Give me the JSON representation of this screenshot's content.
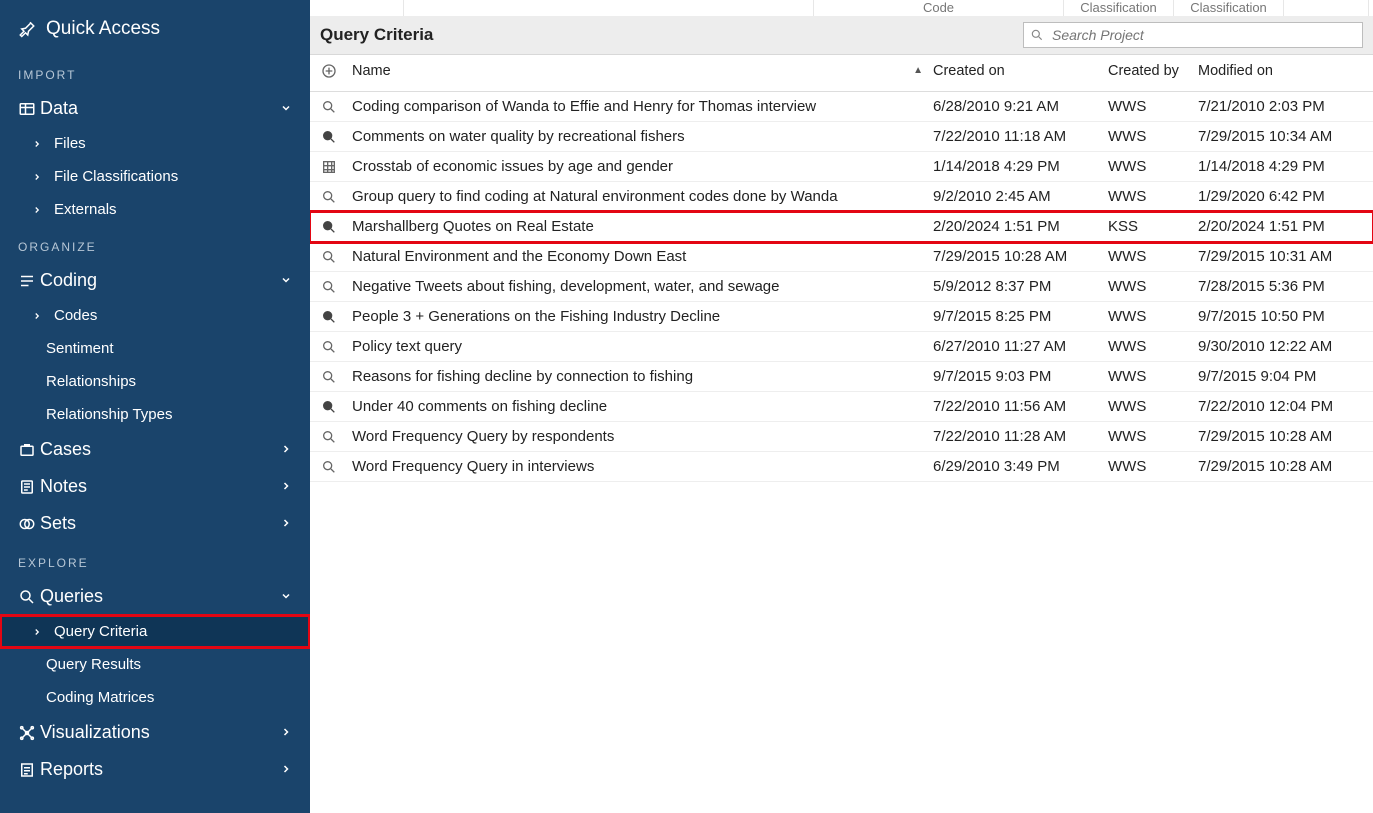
{
  "sidebar": {
    "quick_access": "Quick Access",
    "sections": {
      "import": "IMPORT",
      "organize": "ORGANIZE",
      "explore": "EXPLORE"
    },
    "data": {
      "label": "Data",
      "files": "Files",
      "file_class": "File Classifications",
      "externals": "Externals"
    },
    "coding": {
      "label": "Coding",
      "codes": "Codes",
      "sentiment": "Sentiment",
      "relationships": "Relationships",
      "rel_types": "Relationship Types"
    },
    "cases": "Cases",
    "notes": "Notes",
    "sets": "Sets",
    "queries": {
      "label": "Queries",
      "criteria": "Query Criteria",
      "results": "Query Results",
      "matrices": "Coding Matrices"
    },
    "visualizations": "Visualizations",
    "reports": "Reports"
  },
  "main": {
    "top_strip": {
      "code": "Code",
      "class1": "Classification",
      "class2": "Classification"
    },
    "criteria_title": "Query Criteria",
    "search_placeholder": "Search Project",
    "headers": {
      "name": "Name",
      "created": "Created on",
      "by": "Created by",
      "mod": "Modified on"
    },
    "rows": [
      {
        "icon": "mag",
        "name": "Coding comparison of Wanda to Effie and Henry for Thomas interview",
        "created": "6/28/2010 9:21 AM",
        "by": "WWS",
        "mod": "7/21/2010 2:03 PM"
      },
      {
        "icon": "magdark",
        "name": "Comments on water quality by recreational fishers",
        "created": "7/22/2010 11:18 AM",
        "by": "WWS",
        "mod": "7/29/2015 10:34 AM"
      },
      {
        "icon": "grid",
        "name": "Crosstab of economic issues by age and gender",
        "created": "1/14/2018 4:29 PM",
        "by": "WWS",
        "mod": "1/14/2018 4:29 PM"
      },
      {
        "icon": "mag",
        "name": "Group query to find coding at Natural environment codes done by Wanda",
        "created": "9/2/2010 2:45 AM",
        "by": "WWS",
        "mod": "1/29/2020 6:42 PM"
      },
      {
        "icon": "magdark",
        "name": "Marshallberg Quotes on Real Estate",
        "created": "2/20/2024 1:51 PM",
        "by": "KSS",
        "mod": "2/20/2024 1:51 PM",
        "hl": true
      },
      {
        "icon": "mag",
        "name": "Natural Environment and the Economy Down East",
        "created": "7/29/2015 10:28 AM",
        "by": "WWS",
        "mod": "7/29/2015 10:31 AM"
      },
      {
        "icon": "mag",
        "name": "Negative Tweets about fishing, development, water, and sewage",
        "created": "5/9/2012 8:37 PM",
        "by": "WWS",
        "mod": "7/28/2015 5:36 PM"
      },
      {
        "icon": "magdark",
        "name": "People 3 + Generations on the Fishing Industry Decline",
        "created": "9/7/2015 8:25 PM",
        "by": "WWS",
        "mod": "9/7/2015 10:50 PM"
      },
      {
        "icon": "mag",
        "name": "Policy text query",
        "created": "6/27/2010 11:27 AM",
        "by": "WWS",
        "mod": "9/30/2010 12:22 AM"
      },
      {
        "icon": "mag",
        "name": "Reasons for fishing decline by connection to fishing",
        "created": "9/7/2015 9:03 PM",
        "by": "WWS",
        "mod": "9/7/2015 9:04 PM"
      },
      {
        "icon": "magdark",
        "name": "Under 40 comments on fishing decline",
        "created": "7/22/2010 11:56 AM",
        "by": "WWS",
        "mod": "7/22/2010 12:04 PM"
      },
      {
        "icon": "mag",
        "name": "Word Frequency Query by respondents",
        "created": "7/22/2010 11:28 AM",
        "by": "WWS",
        "mod": "7/29/2015 10:28 AM"
      },
      {
        "icon": "mag",
        "name": "Word Frequency Query in interviews",
        "created": "6/29/2010 3:49 PM",
        "by": "WWS",
        "mod": "7/29/2015 10:28 AM"
      }
    ]
  }
}
